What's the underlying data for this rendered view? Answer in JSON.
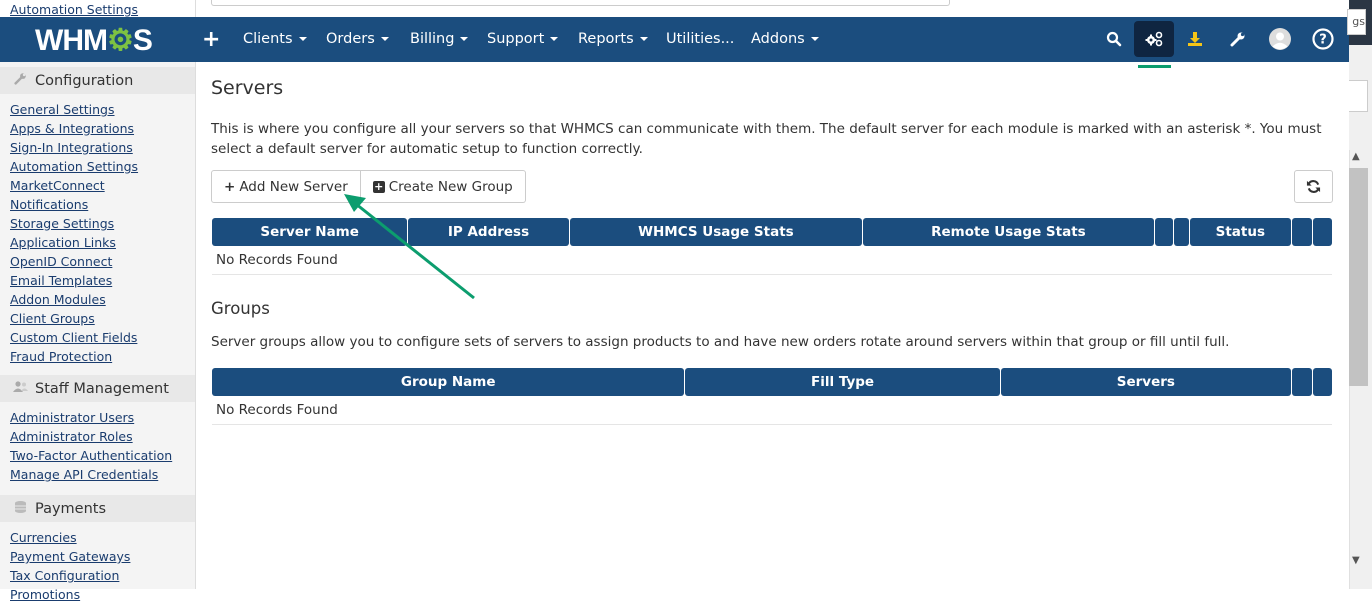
{
  "top_strip": {
    "prev_link": "Automation Settings"
  },
  "navbar": {
    "logo_text_a": "WHM",
    "logo_text_b": "⚙",
    "logo_text_c": "S",
    "add_icon": "+",
    "items": [
      {
        "label": "Clients",
        "dropdown": true
      },
      {
        "label": "Orders",
        "dropdown": true
      },
      {
        "label": "Billing",
        "dropdown": true
      },
      {
        "label": "Support",
        "dropdown": true
      },
      {
        "label": "Reports",
        "dropdown": true
      },
      {
        "label": "Utilities...",
        "dropdown": false
      },
      {
        "label": "Addons",
        "dropdown": true
      }
    ],
    "icons": [
      "search-icon",
      "cogs-icon",
      "download-icon",
      "wrench-icon",
      "avatar",
      "help-icon"
    ],
    "active_icon": "cogs-icon",
    "active_color": "#0c9d6e"
  },
  "sidebar": {
    "sections": [
      {
        "title": "Configuration",
        "icon": "wrench-icon",
        "items": [
          "General Settings",
          "Apps & Integrations",
          "Sign-In Integrations",
          "Automation Settings",
          "MarketConnect",
          "Notifications",
          "Storage Settings",
          "Application Links",
          "OpenID Connect",
          "Email Templates",
          "Addon Modules",
          "Client Groups",
          "Custom Client Fields",
          "Fraud Protection"
        ]
      },
      {
        "title": "Staff Management",
        "icon": "users-icon",
        "items": [
          "Administrator Users",
          "Administrator Roles",
          "Two-Factor Authentication",
          "Manage API Credentials"
        ]
      },
      {
        "title": "Payments",
        "icon": "coins-icon",
        "items": [
          "Currencies",
          "Payment Gateways",
          "Tax Configuration",
          "Promotions"
        ]
      }
    ]
  },
  "main": {
    "title": "Servers",
    "description": "This is where you configure all your servers so that WHMCS can communicate with them. The default server for each module is marked with an asterisk *. You must select a default server for automatic setup to function correctly.",
    "buttons": {
      "add_server": "Add New Server",
      "create_group": "Create New Group"
    },
    "servers_table": {
      "columns": [
        "Server Name",
        "IP Address",
        "WHMCS Usage Stats",
        "Remote Usage Stats",
        "",
        "",
        "Status",
        "",
        ""
      ],
      "empty": "No Records Found"
    },
    "groups_title": "Groups",
    "groups_description": "Server groups allow you to configure sets of servers to assign products to and have new orders rotate around servers within that group or fill until full.",
    "groups_table": {
      "columns": [
        "Group Name",
        "Fill Type",
        "Servers",
        "",
        ""
      ],
      "empty": "No Records Found"
    }
  },
  "scroll_overlay_text": "gs",
  "annotation": {
    "arrow_color": "#0c9d6e",
    "points_to": "add-server-button"
  }
}
